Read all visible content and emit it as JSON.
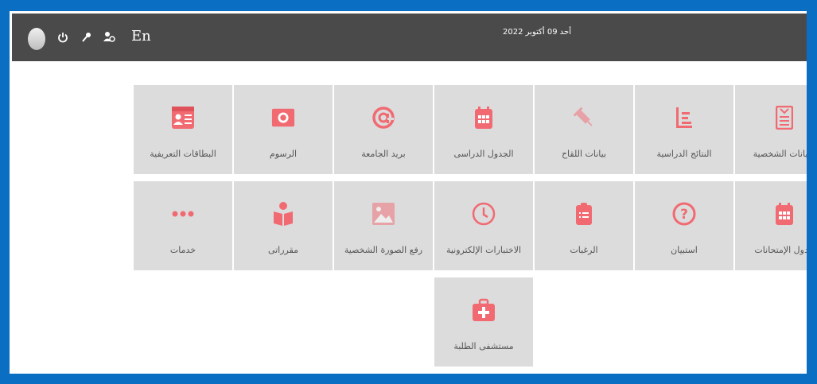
{
  "topbar": {
    "lang_label": "En",
    "date": "أحد 09 أكتوبر 2022",
    "icons": [
      "avatar",
      "power-icon",
      "key-icon",
      "user-settings-icon"
    ]
  },
  "tiles": [
    {
      "id": "personal-data",
      "label": "البيانات الشخصية",
      "icon": "id-form-icon"
    },
    {
      "id": "study-results",
      "label": "النتائج الدراسية",
      "icon": "results-chart-icon"
    },
    {
      "id": "vaccine-data",
      "label": "بيانات اللقاح",
      "icon": "syringe-icon"
    },
    {
      "id": "study-schedule",
      "label": "الجدول الدراسى",
      "icon": "calendar-icon"
    },
    {
      "id": "university-mail",
      "label": "بريد الجامعة",
      "icon": "at-sign-icon"
    },
    {
      "id": "fees",
      "label": "الرسوم",
      "icon": "money-icon"
    },
    {
      "id": "id-cards",
      "label": "البطاقات التعريفية",
      "icon": "id-card-icon"
    },
    {
      "id": "exam-schedule",
      "label": "جدول الإمتحانات",
      "icon": "calendar-icon"
    },
    {
      "id": "survey",
      "label": "استبيان",
      "icon": "question-icon"
    },
    {
      "id": "preferences",
      "label": "الرغبات",
      "icon": "clipboard-icon"
    },
    {
      "id": "electronic-tests",
      "label": "الاختبارات الإلكترونية",
      "icon": "clock-icon"
    },
    {
      "id": "upload-photo",
      "label": "رفع الصورة الشخصية",
      "icon": "image-icon"
    },
    {
      "id": "courses",
      "label": "مقرراتى",
      "icon": "reader-icon"
    },
    {
      "id": "services",
      "label": "خدمات",
      "icon": "more-dots-icon"
    },
    {
      "id": "student-hospital",
      "label": "مستشفى الطلبة",
      "icon": "first-aid-kit-icon"
    }
  ],
  "colors": {
    "accent": "#f16a72",
    "frame": "#0a6fc2",
    "topbar": "#4a4a4a",
    "tile": "#dcdcdc"
  }
}
